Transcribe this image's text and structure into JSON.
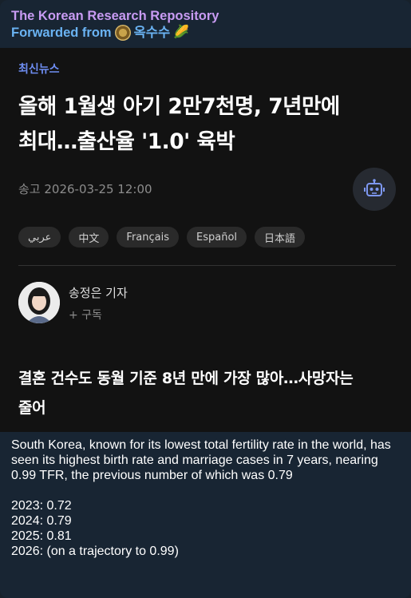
{
  "header": {
    "channel_name": "The Korean Research Repository",
    "forwarded_prefix": "Forwarded from",
    "forwarded_source": "옥수수",
    "source_emoji": "🌽"
  },
  "article": {
    "kicker": "최신뉴스",
    "headline_line1": "올해 1월생 아기 2만7천명, 7년만에",
    "headline_line2": "최대…출산율 '1.0' 육박",
    "dateline": "송고 2026-03-25 12:00",
    "languages": [
      "عربي",
      "中文",
      "Français",
      "Español",
      "日本語"
    ],
    "reporter_name": "송정은 기자",
    "subscribe_label": "+ 구독",
    "subhead_line1": "결혼 건수도 동월 기준 8년 만에 가장 많아…사망자는",
    "subhead_line2": "줄어"
  },
  "message": {
    "summary": "South Korea, known for its lowest total fertility rate in the world, has seen its highest birth rate and marriage cases in 7 years, nearing 0.99 TFR, the previous number of which was 0.79",
    "stats": [
      "2023: 0.72",
      "2024: 0.79",
      "2025: 0.81",
      "2026: (on a trajectory to 0.99)"
    ]
  },
  "colors": {
    "channel_name": "#c89bf3",
    "forwarded": "#6ab3f3",
    "kicker": "#6e8df2",
    "bot_icon": "#7d97f0"
  },
  "icons": {
    "bot": "robot-icon",
    "source_avatar": "source-avatar-icon"
  }
}
